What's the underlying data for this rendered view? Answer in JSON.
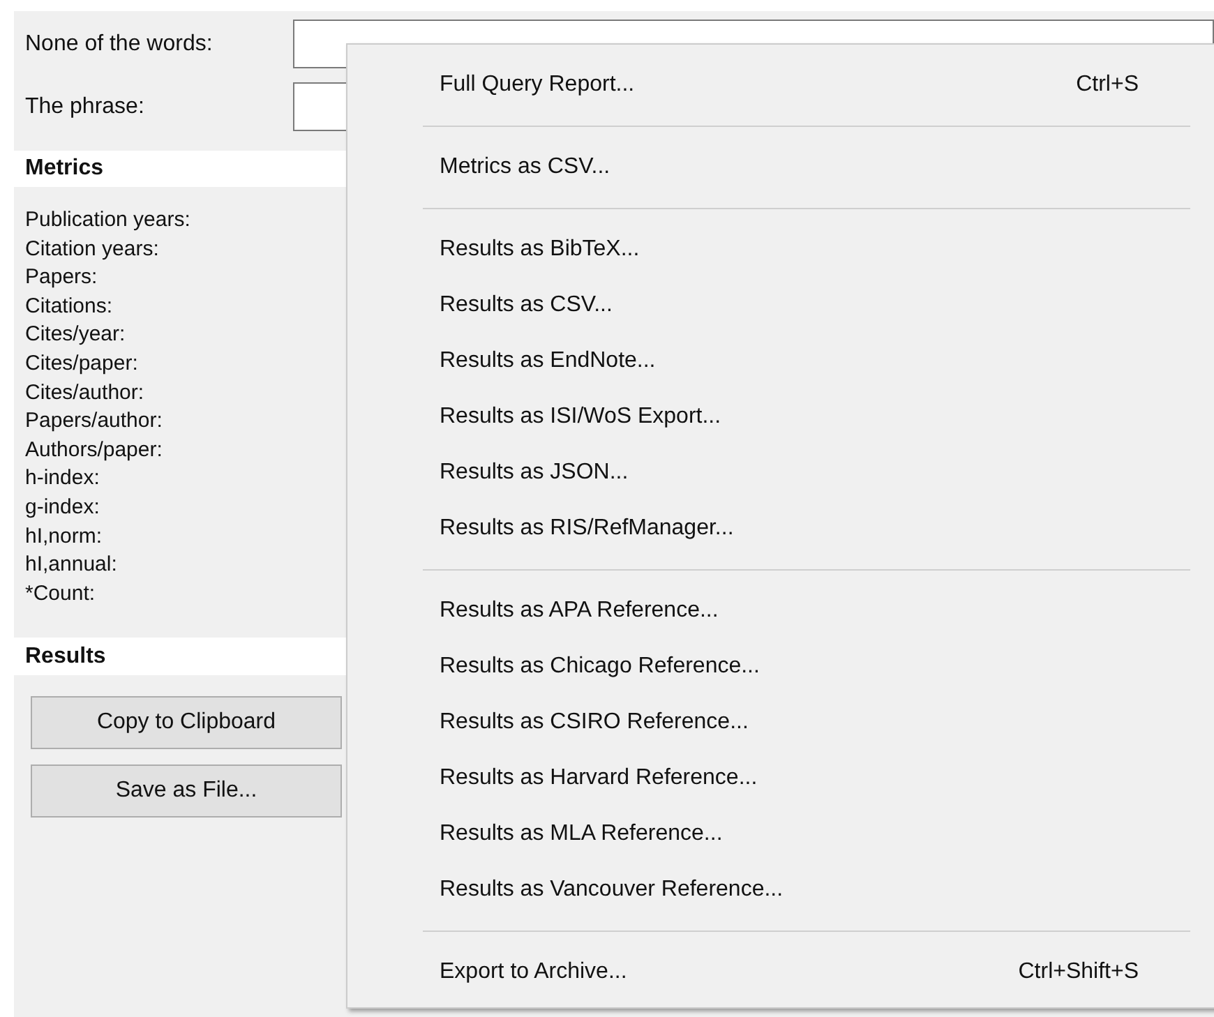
{
  "search_fields": [
    {
      "label": "None of the words:"
    },
    {
      "label": "The phrase:"
    }
  ],
  "metrics": {
    "heading": "Metrics",
    "labels": [
      "Publication years:",
      "Citation years:",
      "Papers:",
      "Citations:",
      "Cites/year:",
      "Cites/paper:",
      "Cites/author:",
      "Papers/author:",
      "Authors/paper:",
      "h-index:",
      "g-index:",
      "hI,norm:",
      "hI,annual:",
      "*Count:"
    ]
  },
  "results": {
    "heading": "Results",
    "buttons": [
      "Copy to Clipboard",
      "Save as File..."
    ]
  },
  "menu": {
    "groups": [
      [
        {
          "label": "Full Query Report...",
          "shortcut": "Ctrl+S"
        }
      ],
      [
        {
          "label": "Metrics as CSV..."
        }
      ],
      [
        {
          "label": "Results as BibTeX..."
        },
        {
          "label": "Results as CSV..."
        },
        {
          "label": "Results as EndNote..."
        },
        {
          "label": "Results as ISI/WoS Export..."
        },
        {
          "label": "Results as JSON..."
        },
        {
          "label": "Results as RIS/RefManager..."
        }
      ],
      [
        {
          "label": "Results as APA Reference..."
        },
        {
          "label": "Results as Chicago Reference..."
        },
        {
          "label": "Results as CSIRO Reference..."
        },
        {
          "label": "Results as Harvard Reference..."
        },
        {
          "label": "Results as MLA Reference..."
        },
        {
          "label": "Results as Vancouver Reference..."
        }
      ],
      [
        {
          "label": "Export to Archive...",
          "shortcut": "Ctrl+Shift+S"
        }
      ]
    ]
  }
}
